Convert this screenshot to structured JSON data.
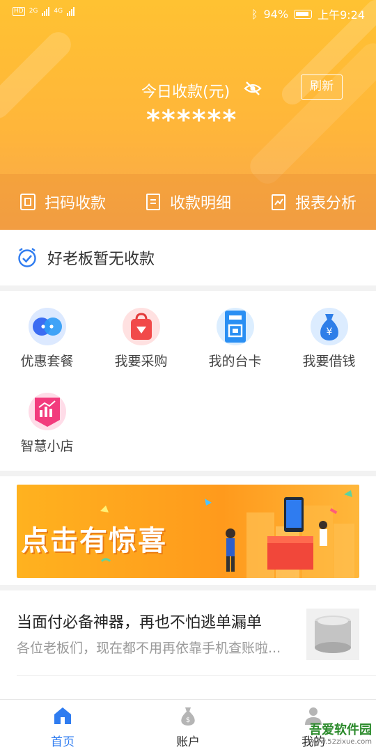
{
  "status_bar": {
    "signal_left": "HD",
    "net1": "2G",
    "net2": "4G",
    "battery": "94%",
    "time": "上午9:24"
  },
  "header": {
    "today_label": "今日收款(元)",
    "amount_masked": "******",
    "refresh_label": "刷新",
    "quick_actions": [
      {
        "label": "扫码收款",
        "icon": "scan-icon"
      },
      {
        "label": "收款明细",
        "icon": "list-icon"
      },
      {
        "label": "报表分析",
        "icon": "report-icon"
      }
    ]
  },
  "notice": {
    "text": "好老板暂无收款",
    "icon": "alarm-check-icon"
  },
  "services": [
    {
      "label": "优惠套餐",
      "icon": "discount-icon",
      "color": "#3b7cf2"
    },
    {
      "label": "我要采购",
      "icon": "shopping-bag-icon",
      "color": "#f14a4a"
    },
    {
      "label": "我的台卡",
      "icon": "qr-card-icon",
      "color": "#2a8ff3"
    },
    {
      "label": "我要借钱",
      "icon": "money-bag-icon",
      "color": "#2e7ee8"
    },
    {
      "label": "智慧小店",
      "icon": "smart-shop-icon",
      "color": "#f23b7d"
    }
  ],
  "banner": {
    "text": "点击有惊喜"
  },
  "article": {
    "title": "当面付必备神器，再也不怕逃单漏单",
    "desc": "各位老板们，现在都不用再依靠手机查账啦..."
  },
  "bottom_nav": [
    {
      "label": "首页",
      "icon": "home-icon",
      "active": true
    },
    {
      "label": "账户",
      "icon": "money-bag-icon",
      "active": false
    },
    {
      "label": "我的",
      "icon": "user-icon",
      "active": false
    }
  ],
  "watermark": {
    "text": "吾爱软件园",
    "sub": "www.52zixue.com"
  },
  "colors": {
    "accent": "#ffb63a",
    "nav_active": "#2f7cf0",
    "text_dark": "#333333"
  }
}
